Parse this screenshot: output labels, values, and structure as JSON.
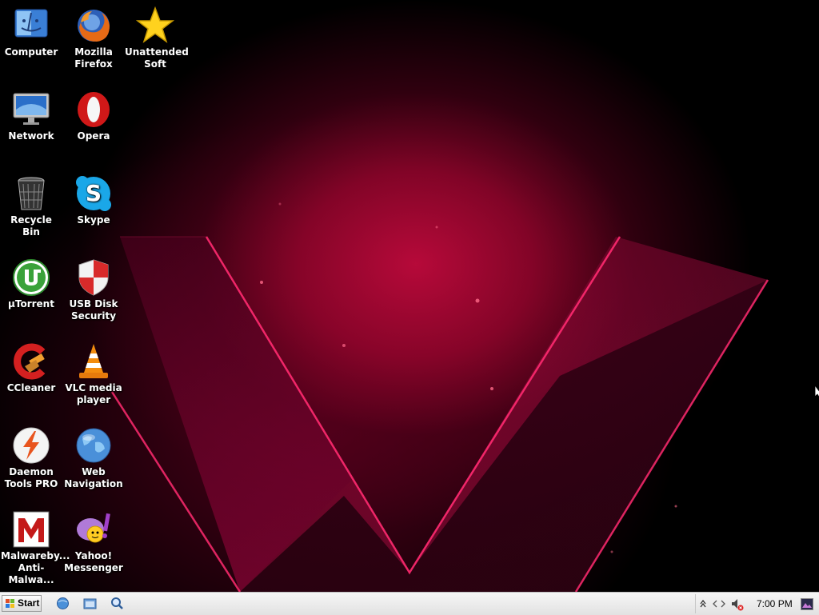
{
  "desktop": {
    "icons": [
      {
        "id": "computer",
        "label": "Computer"
      },
      {
        "id": "firefox",
        "label": "Mozilla Firefox"
      },
      {
        "id": "unattended",
        "label": "Unattended Soft"
      },
      {
        "id": "network",
        "label": "Network"
      },
      {
        "id": "opera",
        "label": "Opera"
      },
      {
        "id": "recycle",
        "label": "Recycle Bin"
      },
      {
        "id": "skype",
        "label": "Skype"
      },
      {
        "id": "utorrent",
        "label": "µTorrent"
      },
      {
        "id": "usbdisk",
        "label": "USB Disk Security"
      },
      {
        "id": "ccleaner",
        "label": "CCleaner"
      },
      {
        "id": "vlc",
        "label": "VLC media player"
      },
      {
        "id": "daemon",
        "label": "Daemon Tools PRO"
      },
      {
        "id": "webnav",
        "label": "Web Navigation"
      },
      {
        "id": "malwarebytes",
        "label": "Malwareby... Anti-Malwa..."
      },
      {
        "id": "yahoo",
        "label": "Yahoo! Messenger"
      }
    ]
  },
  "taskbar": {
    "start_label": "Start",
    "quick_launch": [
      "browser-icon",
      "explorer-icon",
      "search-icon"
    ],
    "tray": {
      "clock": "7:00 PM",
      "icons": [
        "show-hidden-icon",
        "network-icon",
        "volume-muted-icon",
        "show-desktop-icon"
      ]
    }
  },
  "colors": {
    "wallpaper_accent": "#e0105a",
    "taskbar_bg": "#ececec"
  }
}
